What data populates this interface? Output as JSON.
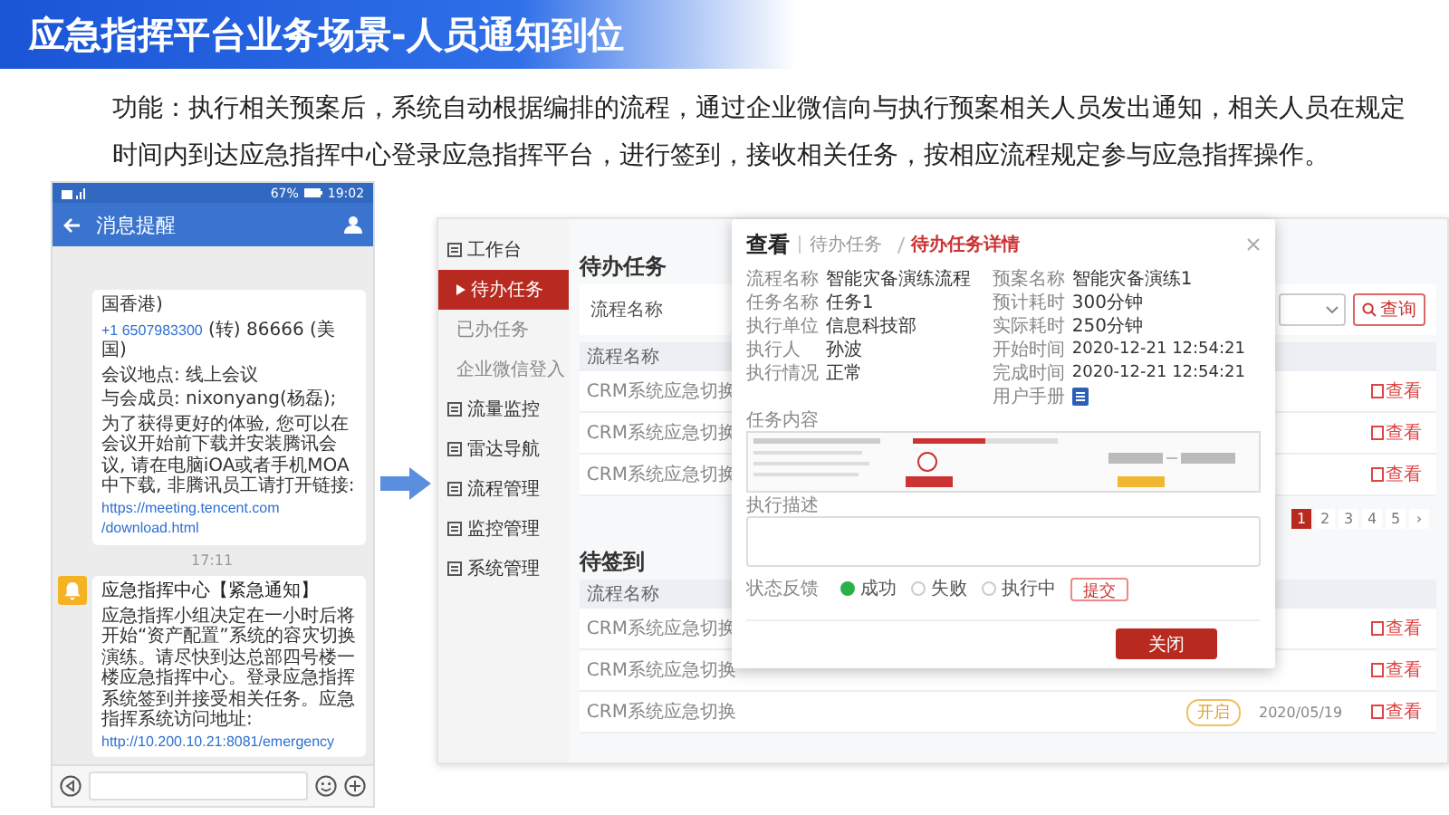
{
  "title": "应急指挥平台业务场景-人员通知到位",
  "description": "功能：执行相关预案后，系统自动根据编排的流程，通过企业微信向与执行预案相关人员发出通知，相关人员在规定时间内到达应急指挥中心登录应急指挥平台，进行签到，接收相关任务，按相应流程规定参与应急指挥操作。",
  "phone": {
    "battery": "67%",
    "time": "19:02",
    "header_title": "消息提醒",
    "messages": [
      {
        "kind": "text",
        "paragraphs": [
          [
            {
              "text": "国香港)"
            }
          ],
          [
            {
              "text": "+1 6507983300",
              "link": true
            },
            {
              "text": " (转) 86666 (美国)"
            }
          ],
          [
            {
              "text": "会议地点: 线上会议"
            }
          ],
          [
            {
              "text": "与会成员: nixonyang(杨磊);"
            }
          ],
          [
            {
              "text": "为了获得更好的体验, 您可以在会议开始前下载并安装腾讯会议, 请在电脑iOA或者手机MOA中下载, 非腾讯员工请打开链接: "
            },
            {
              "text": "https://meeting.tencent.com",
              "link": true
            },
            {
              "text": "/download.html",
              "link": true
            }
          ]
        ]
      },
      {
        "kind": "time",
        "text": "17:11"
      },
      {
        "kind": "notice",
        "title": "应急指挥中心【紧急通知】",
        "paragraphs": [
          [
            {
              "text": "应急指挥小组决定在一小时后将开始“资产配置”系统的容灾切换演练。请尽快到达总部四号楼一楼应急指挥中心。登录应急指挥系统签到并接受相关任务。应急指挥系统访问地址: "
            },
            {
              "text": "http://10.200.10.21:80",
              "link": true
            },
            {
              "text": "81/emergency",
              "link": true
            }
          ]
        ]
      }
    ]
  },
  "app": {
    "sidebar": [
      {
        "label": "工作台",
        "kind": "group",
        "selected": false
      },
      {
        "label": "待办任务",
        "kind": "sub",
        "selected": true
      },
      {
        "label": "已办任务",
        "kind": "sub",
        "selected": false
      },
      {
        "label": "企业微信登入",
        "kind": "sub",
        "selected": false
      },
      {
        "label": "流量监控",
        "kind": "group",
        "selected": false
      },
      {
        "label": "雷达导航",
        "kind": "group",
        "selected": false
      },
      {
        "label": "流程管理",
        "kind": "group",
        "selected": false
      },
      {
        "label": "监控管理",
        "kind": "group",
        "selected": false
      },
      {
        "label": "系统管理",
        "kind": "group",
        "selected": false
      }
    ],
    "pending": {
      "heading": "待办任务",
      "filter_label": "流程名称",
      "search_button": "查询",
      "column": "流程名称",
      "rows": [
        {
          "name": "CRM系统应急切换",
          "action": "查看"
        },
        {
          "name": "CRM系统应急切换",
          "action": "查看"
        },
        {
          "name": "CRM系统应急切换",
          "action": "查看"
        }
      ],
      "pages": [
        {
          "label": "1",
          "selected": true
        },
        {
          "label": "2",
          "selected": false
        },
        {
          "label": "3",
          "selected": false
        },
        {
          "label": "4",
          "selected": false
        },
        {
          "label": "5",
          "selected": false
        },
        {
          "label": "›",
          "selected": false
        }
      ]
    },
    "checkin": {
      "heading": "待签到",
      "column": "流程名称",
      "rows": [
        {
          "name": "CRM系统应急切换",
          "action": "查看"
        },
        {
          "name": "CRM系统应急切换",
          "action": "查看"
        },
        {
          "name": "CRM系统应急切换",
          "tag": "开启",
          "date": "2020/05/19",
          "action": "查看"
        }
      ]
    },
    "modal": {
      "title": "查看",
      "breadcrumb": [
        {
          "label": "待办任务",
          "selected": false
        },
        {
          "label": "待办任务详情",
          "selected": true
        }
      ],
      "fields_left": [
        {
          "label": "流程名称",
          "kind": "text",
          "value": "智能灾备演练流程"
        },
        {
          "label": "任务名称",
          "kind": "text",
          "value": "任务1"
        },
        {
          "label": "执行单位",
          "kind": "text",
          "value": "信息科技部"
        },
        {
          "label": "执行人",
          "kind": "text",
          "value": "孙波"
        },
        {
          "label": "执行情况",
          "kind": "text",
          "value": "正常"
        }
      ],
      "fields_right": [
        {
          "label": "预案名称",
          "kind": "text",
          "value": "智能灾备演练1"
        },
        {
          "label": "预计耗时",
          "kind": "text",
          "value": "300分钟"
        },
        {
          "label": "实际耗时",
          "kind": "text",
          "value": "250分钟"
        },
        {
          "label": "开始时间",
          "kind": "text",
          "value": "2020-12-21 12:54:21"
        },
        {
          "label": "完成时间",
          "kind": "text",
          "value": "2020-12-21 12:54:21"
        },
        {
          "label": "用户手册",
          "kind": "file"
        }
      ],
      "content_label": "任务内容",
      "description_label": "执行描述",
      "status_label": "状态反馈",
      "status_options": [
        {
          "label": "成功",
          "selected": true
        },
        {
          "label": "失败",
          "selected": false
        },
        {
          "label": "执行中",
          "selected": false
        }
      ],
      "submit": "提交",
      "close": "关闭"
    }
  }
}
